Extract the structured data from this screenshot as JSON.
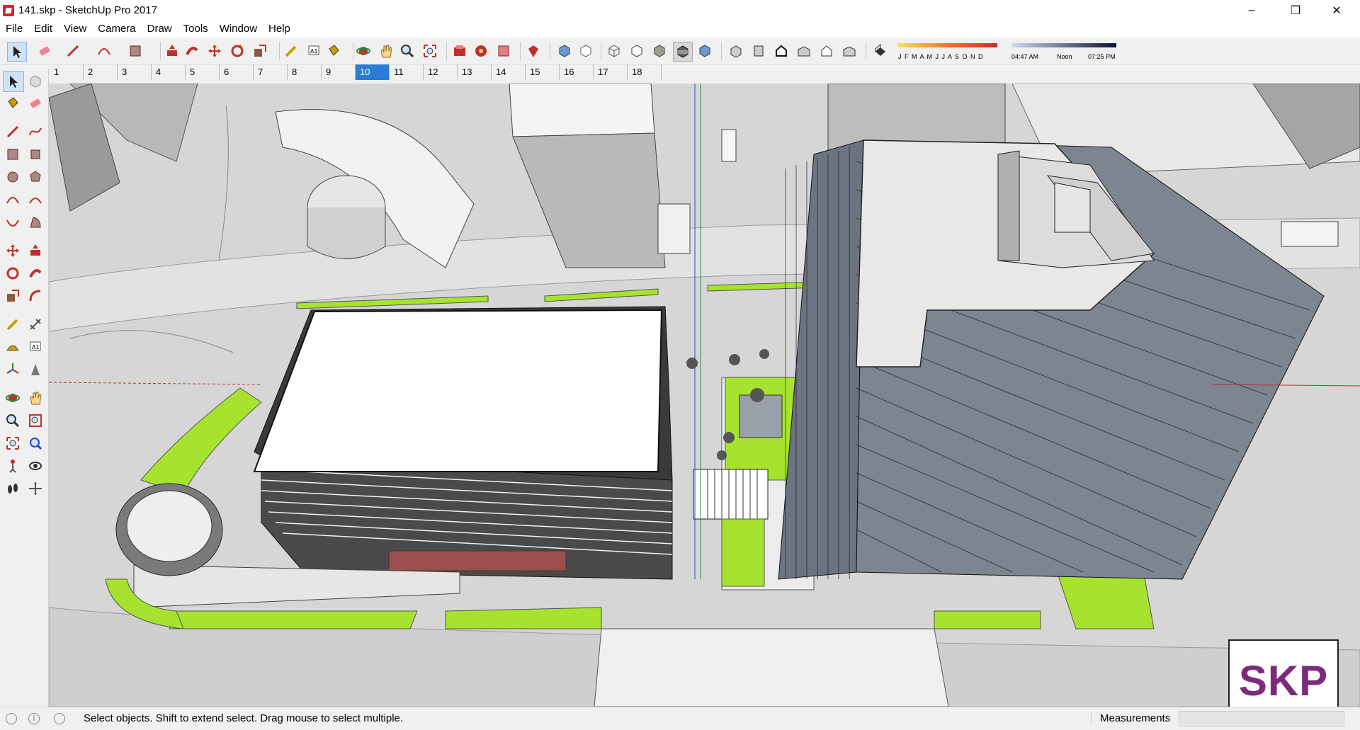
{
  "window": {
    "title": "141.skp - SketchUp Pro 2017",
    "minimize": "–",
    "restore": "❐",
    "close": "✕"
  },
  "menu": [
    "File",
    "Edit",
    "View",
    "Camera",
    "Draw",
    "Tools",
    "Window",
    "Help"
  ],
  "toolbar": {
    "tools": [
      "select-icon",
      "eraser-icon",
      "line-icon",
      "arc-icon",
      "rectangle-icon",
      "push-pull-icon",
      "follow-me-icon",
      "move-icon",
      "rotate-icon",
      "scale-icon",
      "tape-measure-icon",
      "text-icon",
      "paint-bucket-icon",
      "orbit-icon",
      "pan-icon",
      "zoom-icon",
      "zoom-extents-icon",
      "warehouse-icon",
      "extension-warehouse-icon",
      "component-icon",
      "ruby-icon",
      "x-ray-icon",
      "back-edges-icon",
      "wireframe-icon",
      "hidden-line-icon",
      "shaded-icon",
      "shaded-textures-icon",
      "monochrome-icon",
      "iso-view-icon",
      "top-view-icon",
      "front-view-icon",
      "right-view-icon",
      "back-view-icon",
      "left-view-icon",
      "shadows-icon"
    ],
    "shadow_months": "J F M A M J J A S O N D",
    "shadow_time_start": "04:47 AM",
    "shadow_time_mid": "Noon",
    "shadow_time_end": "07:25 PM"
  },
  "scenes": [
    "1",
    "2",
    "3",
    "4",
    "5",
    "6",
    "7",
    "8",
    "9",
    "10",
    "11",
    "12",
    "13",
    "14",
    "15",
    "16",
    "17",
    "18"
  ],
  "active_scene": "10",
  "palette": [
    "select-icon",
    "make-component-icon",
    "paint-bucket-icon",
    "eraser-icon",
    "line-icon",
    "freehand-icon",
    "rectangle-icon",
    "rotated-rectangle-icon",
    "circle-icon",
    "polygon-icon",
    "arc-icon",
    "two-point-arc-icon",
    "three-point-arc-icon",
    "pie-icon",
    "move-icon",
    "push-pull-icon",
    "rotate-icon",
    "follow-me-icon",
    "scale-icon",
    "offset-icon",
    "tape-measure-icon",
    "dimension-icon",
    "protractor-icon",
    "text-icon",
    "axes-icon",
    "3d-text-icon",
    "orbit-icon",
    "pan-icon",
    "zoom-icon",
    "zoom-window-icon",
    "zoom-extents-icon",
    "previous-view-icon",
    "position-camera-icon",
    "look-around-icon",
    "walk-icon",
    "section-plane-icon"
  ],
  "status": {
    "message": "Select objects. Shift to extend select. Drag mouse to select multiple.",
    "measurements_label": "Measurements"
  },
  "badge": "SKP",
  "colors": {
    "active_scene": "#2c7bd6",
    "lawn": "#a6e22e",
    "glass": "#6b7480",
    "badge_text": "#7d2a7e"
  }
}
